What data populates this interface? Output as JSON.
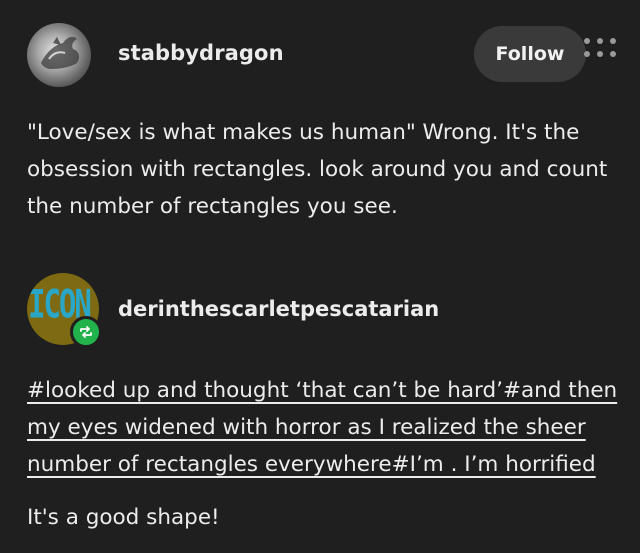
{
  "post": {
    "username": "stabbydragon",
    "follow_label": "Follow",
    "body_lines": [
      "\"Love/sex is what makes us human\" Wrong. It's the",
      "obsession with rectangles. look around you and count",
      "the number of rectangles you see."
    ]
  },
  "reblog": {
    "username": "derinthescarletpescatarian",
    "avatar_text": "ICON",
    "tag_lines": [
      "#looked up and thought ‘that can’t be hard’#and then",
      "my eyes widened with horror as I realized the sheer",
      "number of rectangles everywhere#I’m . I’m horrified"
    ],
    "reply_text": "It's a good shape!"
  },
  "icons": {
    "menu": "more-horizontal-icon",
    "reblog_badge": "reblog-icon"
  },
  "colors": {
    "background": "#1f1f1f",
    "button_bg": "#3a3a3a",
    "reblog_green": "#22b24c",
    "avatar_rb_bg": "#7d6a12",
    "avatar_rb_text": "#2aa6c7"
  }
}
